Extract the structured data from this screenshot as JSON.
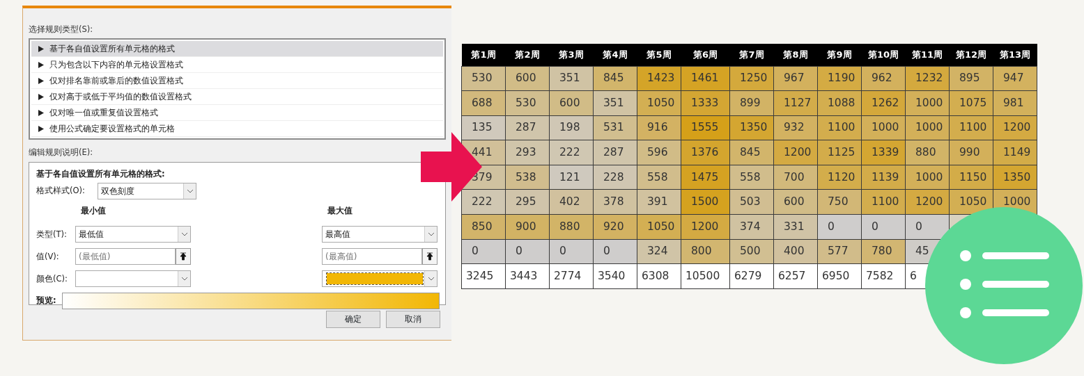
{
  "dialog": {
    "rule_type_label": "选择规则类型(S):",
    "rule_types": [
      {
        "label": "基于各自值设置所有单元格的格式",
        "selected": true
      },
      {
        "label": "只为包含以下内容的单元格设置格式",
        "selected": false
      },
      {
        "label": "仅对排名靠前或靠后的数值设置格式",
        "selected": false
      },
      {
        "label": "仅对高于或低于平均值的数值设置格式",
        "selected": false
      },
      {
        "label": "仅对唯一值或重复值设置格式",
        "selected": false
      },
      {
        "label": "使用公式确定要设置格式的单元格",
        "selected": false
      }
    ],
    "edit_label": "编辑规则说明(E):",
    "description_title": "基于各自值设置所有单元格的格式:",
    "format_style": {
      "label": "格式样式(O):",
      "value": "双色刻度"
    },
    "row_labels": {
      "type": "类型(T):",
      "value": "值(V):",
      "color_label": "颜色(C):",
      "preview": "预览:"
    },
    "minimum": {
      "heading": "最小值",
      "type": "最低值",
      "value_placeholder": "(最低值)",
      "color": "#ffffff"
    },
    "maximum": {
      "heading": "最大值",
      "type": "最高值",
      "value_placeholder": "(最高值)",
      "color": "#f2b705"
    },
    "buttons": [
      "确定",
      "取消"
    ]
  },
  "table": {
    "columns": [
      "第1周",
      "第2周",
      "第3周",
      "第4周",
      "第5周",
      "第6周",
      "第7周",
      "第8周",
      "第9周",
      "第10周",
      "第11周",
      "第12周",
      "第13周"
    ],
    "rows": [
      [
        "530",
        "600",
        "351",
        "845",
        "1423",
        "1461",
        "1250",
        "967",
        "1190",
        "962",
        "1232",
        "895",
        "947"
      ],
      [
        "688",
        "530",
        "600",
        "351",
        "1050",
        "1333",
        "899",
        "1127",
        "1088",
        "1262",
        "1000",
        "1075",
        "981"
      ],
      [
        "135",
        "287",
        "198",
        "531",
        "916",
        "1555",
        "1350",
        "932",
        "1100",
        "1000",
        "1000",
        "1100",
        "1200"
      ],
      [
        "441",
        "293",
        "222",
        "287",
        "596",
        "1376",
        "845",
        "1200",
        "1125",
        "1339",
        "880",
        "990",
        "1149"
      ],
      [
        "379",
        "538",
        "121",
        "228",
        "558",
        "1475",
        "558",
        "700",
        "1120",
        "1139",
        "1000",
        "1150",
        "1350"
      ],
      [
        "222",
        "295",
        "402",
        "378",
        "391",
        "1500",
        "503",
        "600",
        "750",
        "1100",
        "1200",
        "1050",
        "1000"
      ],
      [
        "850",
        "900",
        "880",
        "920",
        "1050",
        "1200",
        "374",
        "331",
        "0",
        "0",
        "0",
        null,
        null
      ],
      [
        "0",
        "0",
        "0",
        "0",
        "324",
        "800",
        "500",
        "400",
        "577",
        "780",
        "45",
        null,
        null
      ]
    ],
    "totals": [
      "3245",
      "3443",
      "2774",
      "3540",
      "6308",
      "10500",
      "6279",
      "6257",
      "6950",
      "7582",
      "6"
    ]
  }
}
